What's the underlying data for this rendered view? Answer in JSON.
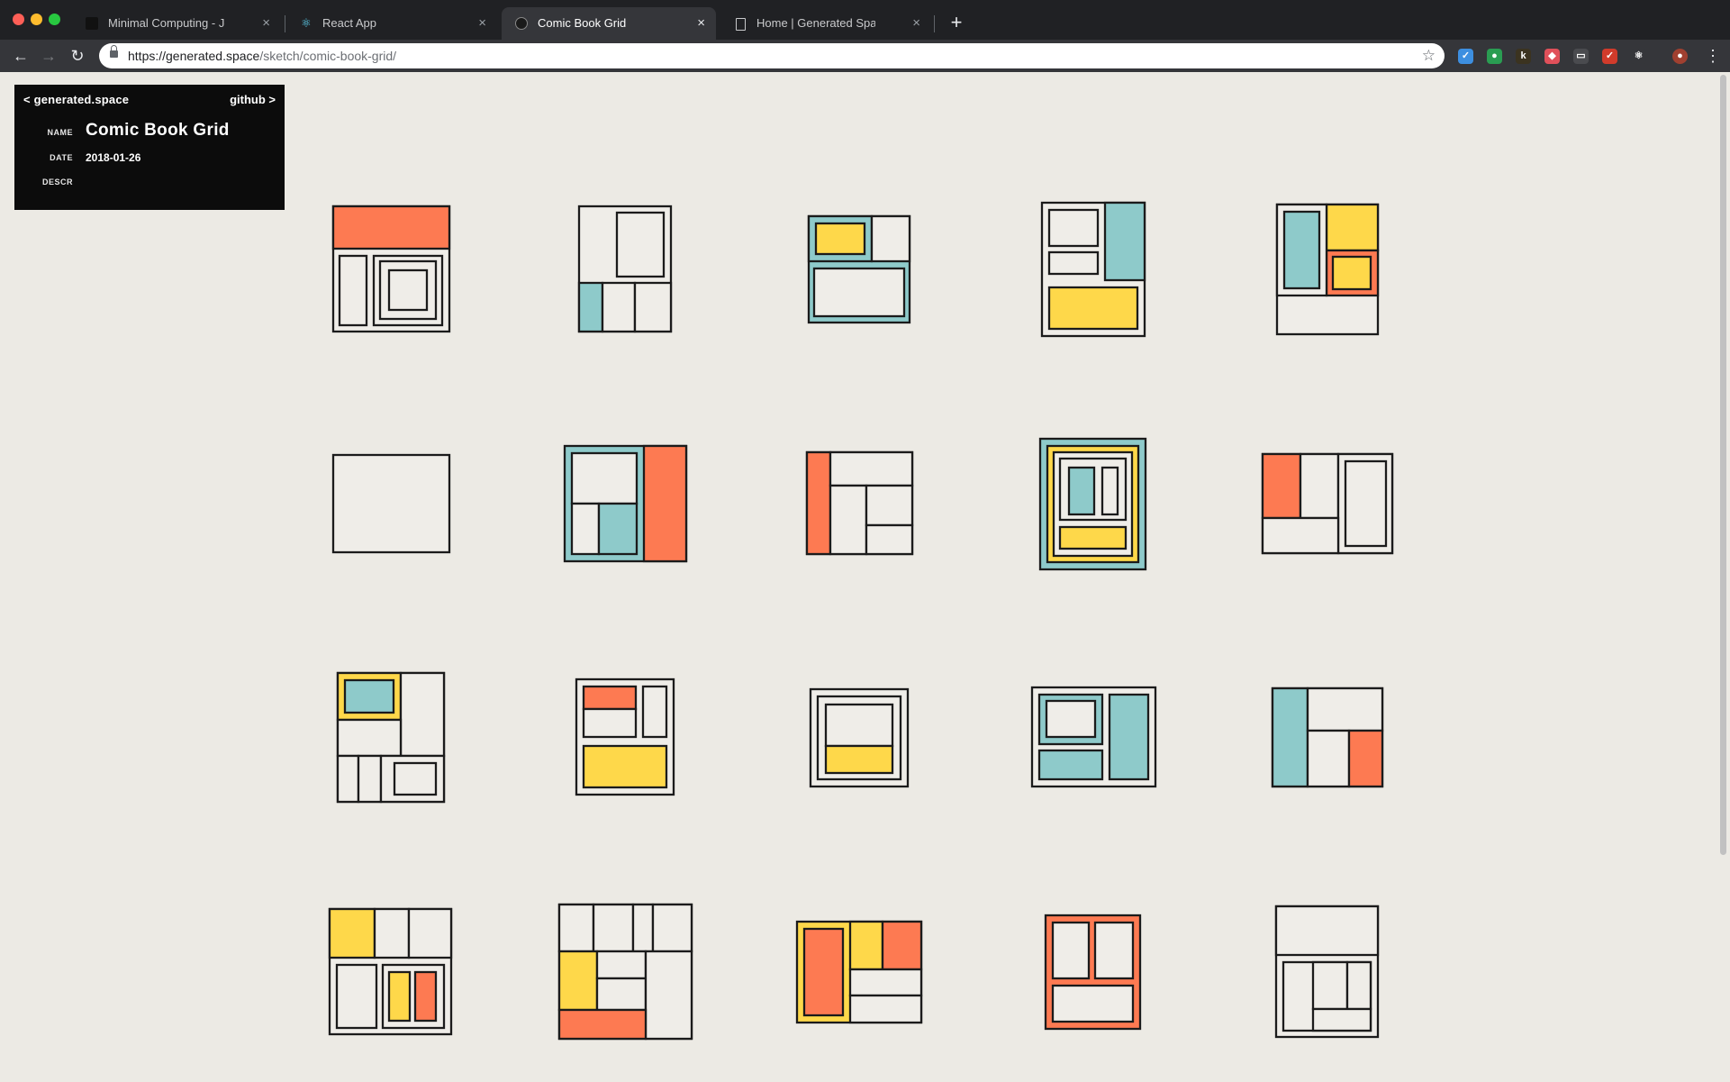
{
  "browser": {
    "tabs": [
      {
        "title": "Minimal Computing - Jesse Kri",
        "icon": "square-favicon-icon",
        "active": false
      },
      {
        "title": "React App",
        "icon": "react-favicon-icon",
        "active": false
      },
      {
        "title": "Comic Book Grid",
        "icon": "github-favicon-icon",
        "active": true
      },
      {
        "title": "Home | Generated Space",
        "icon": "document-favicon-icon",
        "active": false
      }
    ],
    "new_tab": "+",
    "close_glyph": "×",
    "url": {
      "host": "https://generated.space",
      "path": "/sketch/comic-book-grid/"
    },
    "icons": {
      "back": "back-arrow-icon",
      "forward": "forward-arrow-icon",
      "reload": "reload-icon",
      "lock": "lock-icon",
      "bookmark": "star-icon",
      "menu": "kebab-menu-icon"
    },
    "extensions": [
      {
        "name": "extension-blue-icon",
        "glyph": "✓",
        "color": "#3d8fe0"
      },
      {
        "name": "extension-green-icon",
        "glyph": "●",
        "color": "#2a9d52"
      },
      {
        "name": "extension-k-icon",
        "glyph": "k",
        "color": "#3b3320"
      },
      {
        "name": "extension-shield-icon",
        "glyph": "◆",
        "color": "#e0505a"
      },
      {
        "name": "extension-cast-icon",
        "glyph": "▭",
        "color": "#4a4b4f"
      },
      {
        "name": "extension-color-icon",
        "glyph": "✓",
        "color": "#d13b2b"
      },
      {
        "name": "extension-react-icon",
        "glyph": "⚛",
        "color": "#35363a"
      },
      {
        "name": "profile-avatar-icon",
        "glyph": "●",
        "color": "#a04030"
      }
    ]
  },
  "panel": {
    "back_link": "< generated.space",
    "github_link": "github >",
    "name_label": "NAME",
    "name_value": "Comic Book Grid",
    "date_label": "DATE",
    "date_value": "2018-01-26",
    "descr_label": "DESCR",
    "descr_value": ""
  },
  "palette": {
    "background": "#eceae4",
    "panel_fill": "#efede8",
    "stroke": "#1b1b1b",
    "red": "#fd7a52",
    "yellow": "#fed84a",
    "teal": "#8ecaca"
  }
}
